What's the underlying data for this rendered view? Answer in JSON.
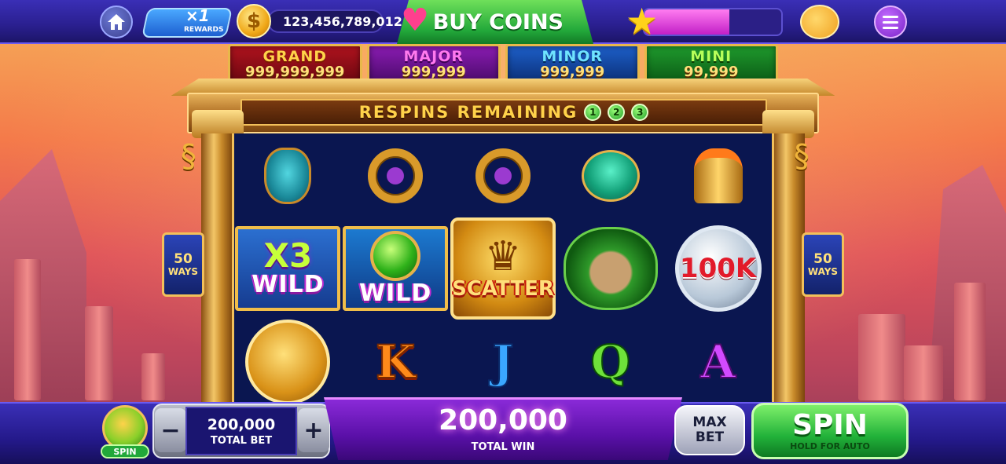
{
  "topbar": {
    "home_icon": "home-icon",
    "rewards": {
      "multiplier": "×1",
      "label": "REWARDS"
    },
    "coins": {
      "icon": "dollar-coin-icon",
      "symbol": "$",
      "balance": "123,456,789,012"
    },
    "buy_coins_label": "BUY COINS",
    "level_progress": 0.62,
    "accent": "#22a83a"
  },
  "jackpots": [
    {
      "name": "GRAND",
      "value": "999,999,999"
    },
    {
      "name": "MAJOR",
      "value": "999,999"
    },
    {
      "name": "MINOR",
      "value": "999,999"
    },
    {
      "name": "MINI",
      "value": "99,999"
    }
  ],
  "respins": {
    "label": "RESPINS REMAINING",
    "counters": [
      "1",
      "2",
      "3"
    ]
  },
  "ways": {
    "left": {
      "num": "50",
      "label": "WAYS"
    },
    "right": {
      "num": "50",
      "label": "WAYS"
    }
  },
  "reels": {
    "row1": [
      "urn",
      "ring",
      "ring",
      "scarab",
      "helmet"
    ],
    "row2": {
      "x3_wild": {
        "mult": "X3",
        "text": "WILD"
      },
      "gem_wild": {
        "text": "WILD"
      },
      "scatter": {
        "text": "SCATTER"
      },
      "medusa": "medusa",
      "prize": {
        "text": "100K"
      }
    },
    "row3": {
      "coin": "medusa-coin",
      "k": "K",
      "j": "J",
      "q": "Q",
      "a": "A"
    }
  },
  "bottombar": {
    "gift_label": "SPIN",
    "bet_minus": "−",
    "bet_plus": "+",
    "total_bet_value": "200,000",
    "total_bet_label": "TOTAL BET",
    "total_win_value": "200,000",
    "total_win_label": "TOTAL WIN",
    "max_bet_line1": "MAX",
    "max_bet_line2": "BET",
    "spin_label": "SPIN",
    "spin_sub": "HOLD FOR AUTO"
  }
}
